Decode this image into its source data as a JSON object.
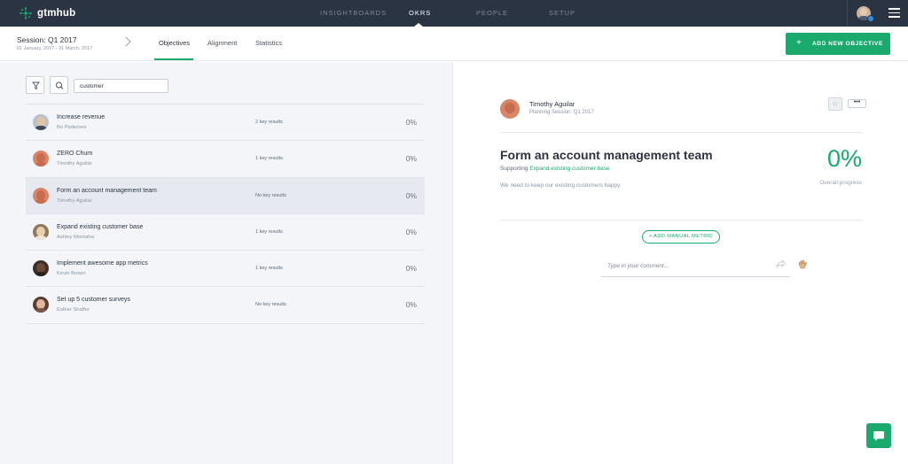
{
  "app": {
    "name": "gtmhub",
    "nav": [
      {
        "label": "INSIGHTBOARDS",
        "active": false
      },
      {
        "label": "OKRS",
        "active": true
      },
      {
        "label": "PEOPLE",
        "active": false
      },
      {
        "label": "SETUP",
        "active": false
      }
    ],
    "user_badge_color": "#2e8fe0"
  },
  "session": {
    "title": "Session: Q1 2017",
    "dates": "01 January, 2017 - 31 March, 2017"
  },
  "tabs": [
    {
      "label": "Objectives",
      "active": true
    },
    {
      "label": "Alignment",
      "active": false
    },
    {
      "label": "Statistics",
      "active": false
    }
  ],
  "add_objective_label": "ADD NEW OBJECTIVE",
  "search": {
    "value": "customer",
    "filter_icon": "filter-icon",
    "search_icon": "search-icon"
  },
  "objectives": [
    {
      "title": "Increase revenue",
      "owner": "Bo Pedersen",
      "key_results": "2 key results",
      "progress": "0%",
      "selected": false
    },
    {
      "title": "ZERO Churn",
      "owner": "Timothy Aguilar",
      "key_results": "1 key results",
      "progress": "0%",
      "selected": false
    },
    {
      "title": "Form an account management team",
      "owner": "Timothy Aguilar",
      "key_results": "No key results",
      "progress": "0%",
      "selected": true
    },
    {
      "title": "Expand existing customer base",
      "owner": "Ashley Montalvo",
      "key_results": "1 key results",
      "progress": "0%",
      "selected": false
    },
    {
      "title": "Implement awesome app metrics",
      "owner": "Kevin Brown",
      "key_results": "1 key results",
      "progress": "0%",
      "selected": false
    },
    {
      "title": "Set up 5 customer surveys",
      "owner": "Esther Shaffer",
      "key_results": "No key results",
      "progress": "0%",
      "selected": false
    }
  ],
  "detail": {
    "owner_name": "Timothy Aguilar",
    "session_label": "Planning Session: Q1 2017",
    "title": "Form an account management team",
    "supporting_prefix": "Supporting",
    "supporting_link": "Expand existing customer base",
    "description": "We need to keep our existing customers happy.",
    "progress": "0%",
    "progress_label": "Overall progress",
    "more_label": "•••",
    "add_metric_label": "+ ADD MANUAL METRIC",
    "comment_placeholder": "Type in your comment..."
  },
  "colors": {
    "accent": "#1aaa6e",
    "topbar": "#2a3443",
    "panel": "#f3f5f8"
  }
}
